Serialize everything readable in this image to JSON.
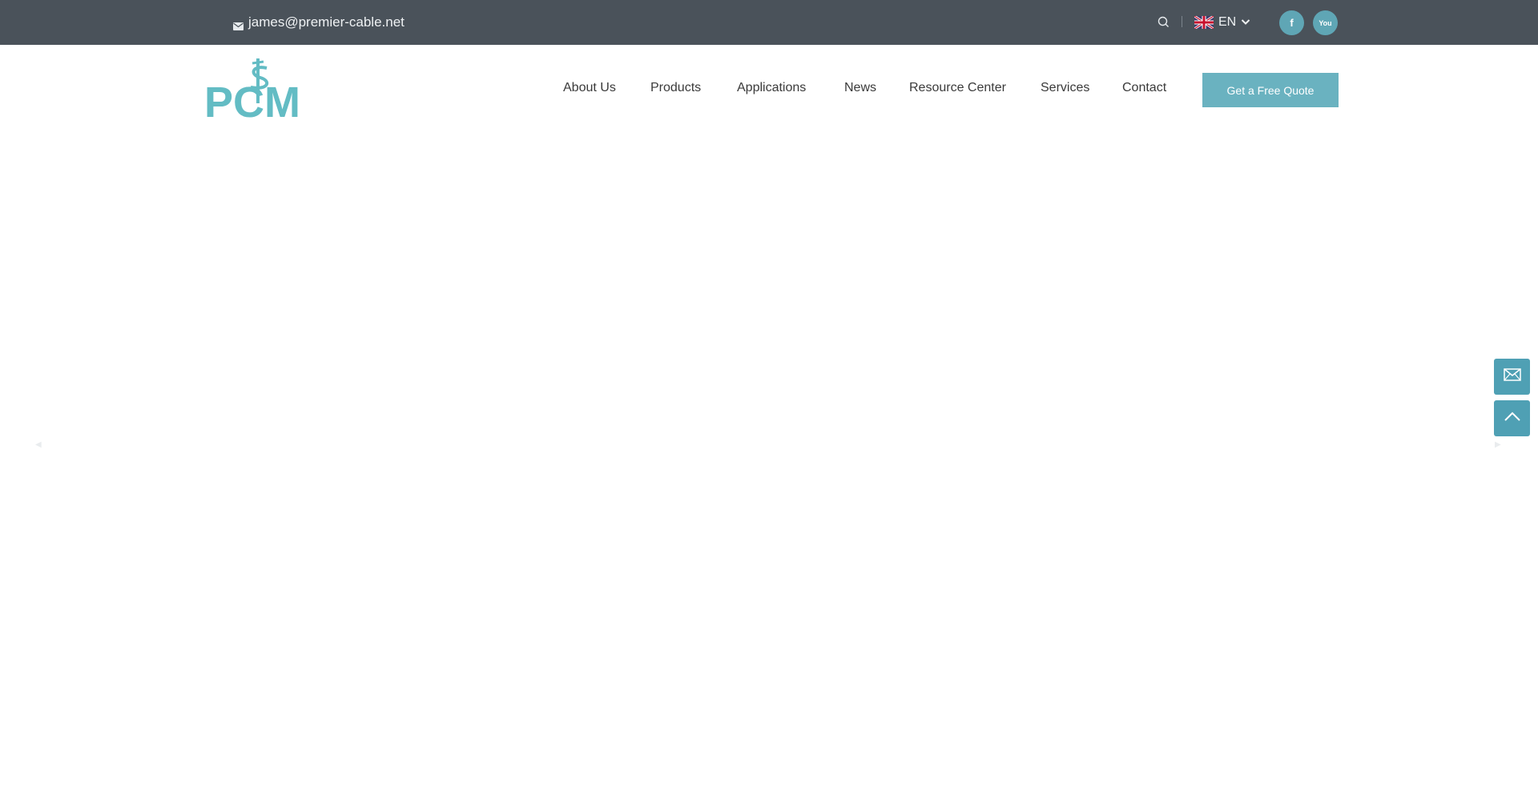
{
  "topbar": {
    "email": "james@premier-cable.net",
    "language": "EN",
    "icons": {
      "mail": "envelope-icon",
      "search": "search-icon",
      "flag": "uk-flag-icon",
      "language_caret": "chevron-down-icon",
      "facebook": "facebook-icon",
      "youtube": "youtube-icon"
    },
    "social": {
      "facebook_glyph": "f",
      "youtube_glyph": "You"
    }
  },
  "header": {
    "logo_text": "PCM",
    "nav": [
      {
        "label": "About Us"
      },
      {
        "label": "Products"
      },
      {
        "label": "Applications"
      },
      {
        "label": "News"
      },
      {
        "label": "Resource Center"
      },
      {
        "label": "Services"
      },
      {
        "label": "Contact"
      }
    ],
    "quote_button": "Get a Free Quote"
  },
  "floating": {
    "mail_icon": "envelope-outline-icon",
    "top_icon": "chevron-up-icon"
  },
  "colors": {
    "topbar_bg": "#4a525a",
    "accent": "#6ab2c0",
    "float_btn": "#4fa0b4",
    "logo": "#63bcc4"
  }
}
